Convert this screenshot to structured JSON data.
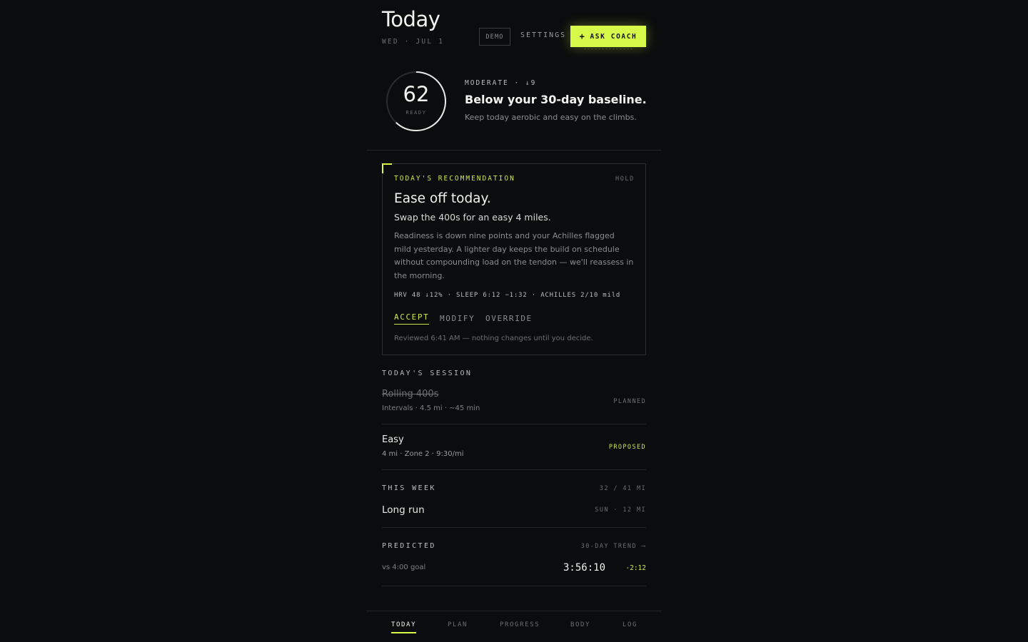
{
  "header": {
    "title": "Today",
    "date": "WED · JUL 1",
    "demo_label": "DEMO",
    "settings_label": "SETTINGS",
    "ask_coach_label": "ASK COACH"
  },
  "readiness": {
    "score": "62",
    "score_label": "READY",
    "score_fraction": 0.62,
    "status": "MODERATE · ↓9",
    "headline": "Below your 30-day baseline.",
    "subline": "Keep today aerobic and easy on the climbs."
  },
  "recommendation": {
    "label": "TODAY'S RECOMMENDATION",
    "status": "HOLD",
    "title": "Ease off today.",
    "subtitle": "Swap the 400s for an easy 4 miles.",
    "body": "Readiness is down nine points and your Achilles flagged mild yesterday. A lighter day keeps the build on schedule without compounding load on the tendon — we'll reassess in the morning.",
    "metrics": "HRV 48 ↓12% · SLEEP 6:12 −1:32 · ACHILLES 2/10 mild",
    "actions": {
      "accept": "ACCEPT",
      "modify": "MODIFY",
      "override": "OVERRIDE"
    },
    "reviewed": "Reviewed 6:41 AM — nothing changes until you decide."
  },
  "session": {
    "label": "TODAY'S SESSION",
    "planned": {
      "title": "Rolling 400s",
      "detail": "Intervals · 4.5 mi · ~45 min",
      "tag": "PLANNED"
    },
    "proposed": {
      "title": "Easy",
      "detail": "4 mi · Zone 2 · 9:30/mi",
      "tag": "PROPOSED"
    }
  },
  "week": {
    "label": "THIS WEEK",
    "mileage": "32 / 41 MI",
    "item_title": "Long run",
    "item_detail": "SUN · 12 MI"
  },
  "predicted": {
    "label": "PREDICTED",
    "trend_link": "30-DAY TREND ⟶",
    "goal": "vs 4:00 goal",
    "time": "3:56:10",
    "delta": "-2:12"
  },
  "nav": {
    "items": [
      "TODAY",
      "PLAN",
      "PROGRESS",
      "BODY",
      "LOG"
    ]
  },
  "colors": {
    "accent": "#d7f94a",
    "background": "#0b0c0d"
  }
}
